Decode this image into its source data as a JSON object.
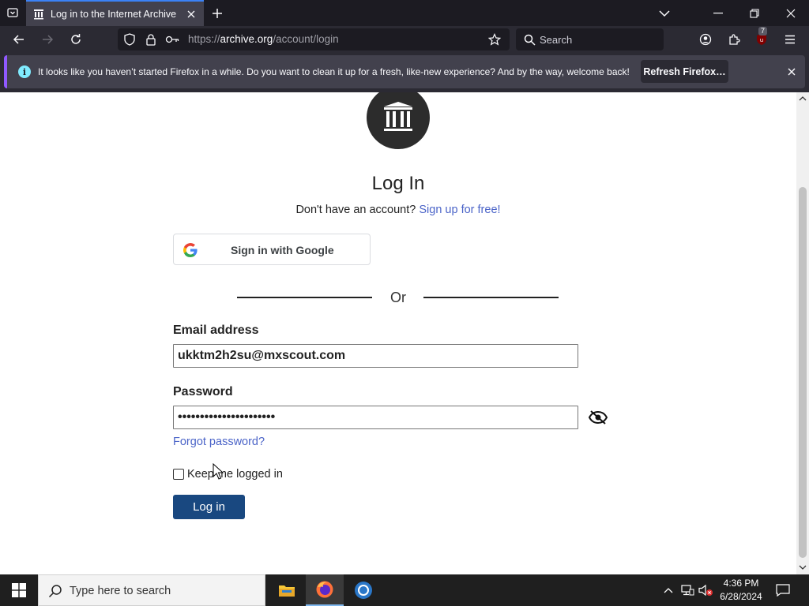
{
  "browser": {
    "tab": {
      "title": "Log in to the Internet Archive"
    },
    "url": {
      "scheme": "https://",
      "host": "archive.org",
      "path": "/account/login"
    },
    "search_placeholder": "Search",
    "extension_badge": "7"
  },
  "notification": {
    "message": "It looks like you haven’t started Firefox in a while. Do you want to clean it up for a fresh, like-new experience? And by the way, welcome back!",
    "refresh_label": "Refresh Firefox…"
  },
  "login": {
    "title": "Log In",
    "no_account_text": "Don't have an account?",
    "signup_link": "Sign up for free!",
    "google_label": "Sign in with Google",
    "or_text": "Or",
    "email_label": "Email address",
    "email_value": "ukktm2h2su@mxscout.com",
    "password_label": "Password",
    "password_value": "••••••••••••••••••••••",
    "forgot_label": "Forgot password?",
    "keep_label": "Keep me logged in",
    "keep_checked": false,
    "login_button": "Log in"
  },
  "taskbar": {
    "search_placeholder": "Type here to search",
    "time": "4:36 PM",
    "date": "6/28/2024"
  },
  "colors": {
    "accent_tab": "#3b82f6",
    "link": "#4b64c8",
    "login_button": "#194880",
    "notification_border": "#9059ff"
  }
}
